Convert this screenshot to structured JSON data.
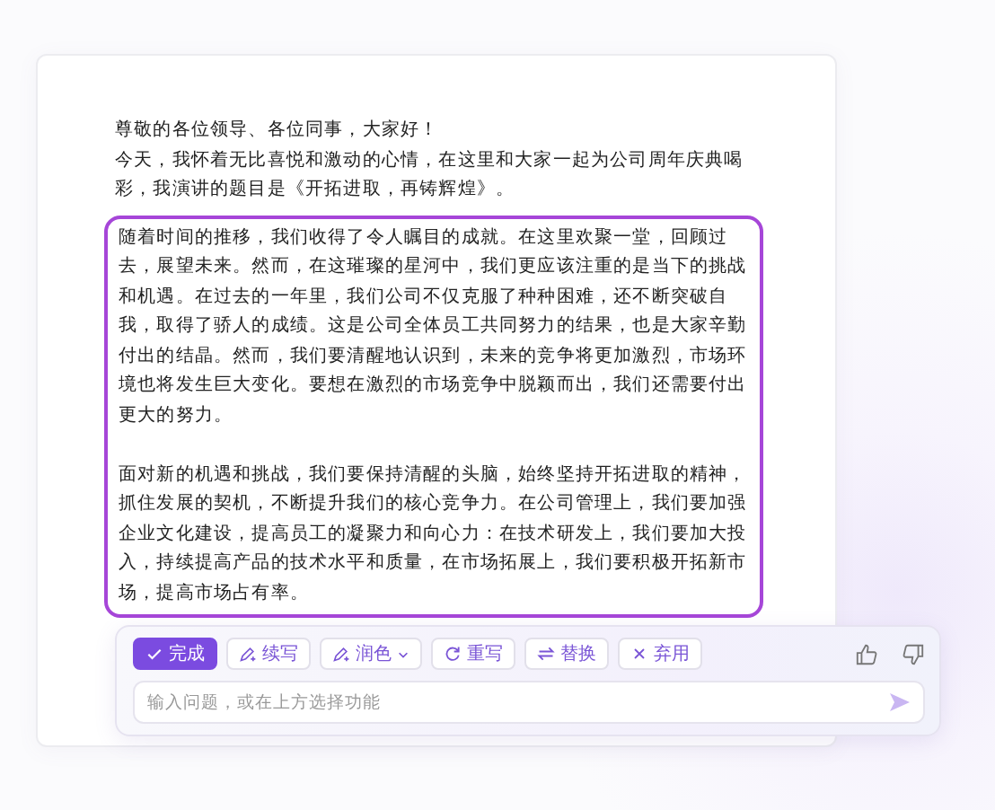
{
  "document": {
    "paragraphs": [
      "尊敬的各位领导、各位同事，大家好！",
      "今天，我怀着无比喜悦和激动的心情，在这里和大家一起为公司周年庆典喝彩，我演讲的题目是《开拓进取，再铸辉煌》。"
    ]
  },
  "selection": {
    "paragraphs": [
      "随着时间的推移，我们收得了令人瞩目的成就。在这里欢聚一堂，回顾过去，展望未来。然而，在这璀璨的星河中，我们更应该注重的是当下的挑战和机遇。在过去的一年里，我们公司不仅克服了种种困难，还不断突破自我，取得了骄人的成绩。这是公司全体员工共同努力的结果，也是大家辛勤付出的结晶。然而，我们要清醒地认识到，未来的竞争将更加激烈，市场环境也将发生巨大变化。要想在激烈的市场竞争中脱颖而出，我们还需要付出更大的努力。",
      "面对新的机遇和挑战，我们要保持清醒的头脑，始终坚持开拓进取的精神，抓住发展的契机，不断提升我们的核心竞争力。在公司管理上，我们要加强企业文化建设，提高员工的凝聚力和向心力：在技术研发上，我们要加大投入，持续提高产品的技术水平和质量，在市场拓展上，我们要积极开拓新市场，提高市场占有率。"
    ]
  },
  "assistant": {
    "actions": [
      {
        "label": "完成",
        "kind": "confirm",
        "has_menu": false
      },
      {
        "label": "续写",
        "kind": "continue",
        "has_menu": false
      },
      {
        "label": "润色",
        "kind": "polish",
        "has_menu": true
      },
      {
        "label": "重写",
        "kind": "rewrite",
        "has_menu": false
      },
      {
        "label": "替换",
        "kind": "replace",
        "has_menu": false
      },
      {
        "label": "弃用",
        "kind": "discard",
        "has_menu": false
      }
    ],
    "input": {
      "placeholder": "输入问题，或在上方选择功能"
    }
  }
}
